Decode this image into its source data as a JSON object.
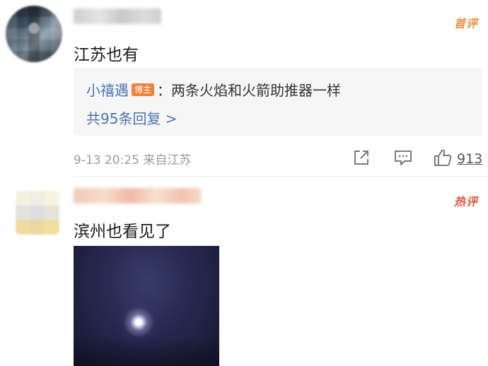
{
  "comments": [
    {
      "badge": "首评",
      "text": "江苏也有",
      "reply": {
        "author": "小禧遇",
        "author_tag": "博主",
        "separator": "：",
        "text": "两条火焰和火箭助推器一样",
        "more_label": "共95条回复 >"
      },
      "meta": "9-13 20:25 来自江苏",
      "like_count": "913"
    },
    {
      "badge": "热评",
      "text": "滨州也看见了"
    }
  ],
  "colors": {
    "link": "#4b76b0",
    "first_badge": "#f08a3c",
    "hot_badge": "#e2573c",
    "author_tag_bg": "#f0803a"
  },
  "icons": [
    "share-icon",
    "comment-icon",
    "thumbs-up-icon"
  ]
}
